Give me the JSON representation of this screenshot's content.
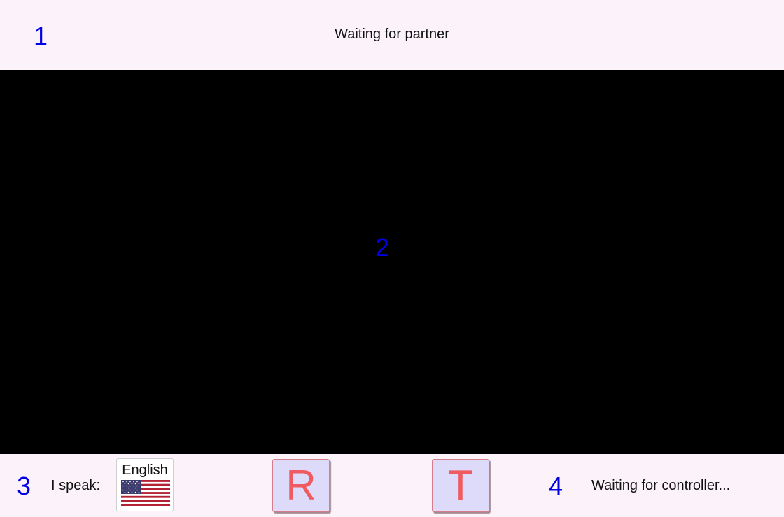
{
  "header": {
    "marker": "1",
    "status": "Waiting for partner"
  },
  "video": {
    "marker": "2"
  },
  "footer": {
    "left_marker": "3",
    "speak_label": "I speak:",
    "language": {
      "label": "English",
      "flag_icon": "us-flag-icon"
    },
    "r_button": "R",
    "t_button": "T",
    "right_marker": "4",
    "status": "Waiting for controller..."
  },
  "colors": {
    "background": "#fbf3f9",
    "marker": "#0000e6",
    "video": "#000000",
    "key_fill": "#dedafa",
    "key_text": "#ef5b60"
  }
}
